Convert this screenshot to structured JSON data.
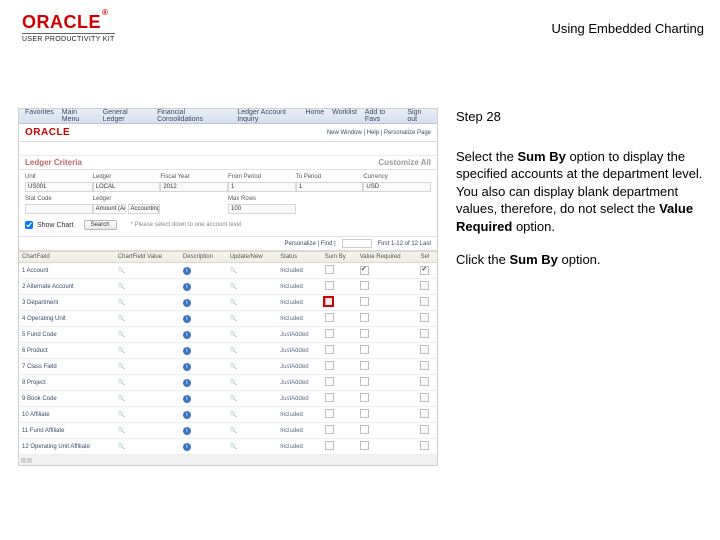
{
  "header": {
    "brand_main": "ORACLE",
    "brand_tm": "®",
    "brand_sub": "USER PRODUCTIVITY KIT",
    "doc_title": "Using Embedded Charting"
  },
  "instructions": {
    "step_label": "Step 28",
    "p1_a": "Select the ",
    "p1_b_bold": "Sum By",
    "p1_c": " option to display the specified accounts at the department level. You also can display blank department values, therefore, do not select the ",
    "p1_d_bold": "Value Required",
    "p1_e": " option.",
    "p2_a": "Click the ",
    "p2_b_bold": "Sum By",
    "p2_c": " option."
  },
  "shot": {
    "top_left": [
      "Favorites",
      "Main Menu",
      "General Ledger",
      "Financial Consolidations",
      "Ledger Account Inquiry"
    ],
    "top_right": [
      "Home",
      "Worklist",
      "Add to Favs",
      "Sign out"
    ],
    "brand": "ORACLE",
    "brand_links": "New Window | Help | Personalize Page",
    "panel_title": "Ledger Criteria",
    "panel_action": "Customize All",
    "filters": [
      {
        "label": "Unit",
        "v1": "US001"
      },
      {
        "label": "Ledger",
        "v1": "LOCAL"
      },
      {
        "label": "Fiscal Year",
        "v1": "2012"
      },
      {
        "label": "From Period",
        "v1": "1"
      },
      {
        "label": "To Period",
        "v1": "1"
      },
      {
        "label": "Currency",
        "v1": "USD"
      }
    ],
    "filters2": [
      {
        "label": "Stat Code",
        "v1": ""
      },
      {
        "label": "Ledger",
        "v1": "Amount (Actuals)",
        "v2": "Accounting Period"
      },
      {
        "label": "",
        "v1": ""
      },
      {
        "label": "Max Rows",
        "v1": "100"
      },
      {
        "label": "",
        "v1": ""
      }
    ],
    "show_chart_label": "Show Chart",
    "search_btn": "Search",
    "search_note": "* Please select down to one account level.",
    "pager_prev": "Personalize | Find |",
    "pager_range": "First  1-12 of 12  Last",
    "table": {
      "headers": [
        "ChartField",
        "ChartField Value",
        "Description",
        "Update/New",
        "Status",
        "Sum By",
        "Value Required",
        "Sel"
      ],
      "rows": [
        {
          "cf": "1 Account",
          "val": "",
          "status": "Included",
          "sum": false,
          "req": true,
          "sel": true
        },
        {
          "cf": "2 Alternate Account",
          "val": "",
          "status": "Included",
          "sum": false,
          "req": false,
          "sel": false
        },
        {
          "cf": "3 Department",
          "val": "",
          "status": "Included",
          "sum": false,
          "req": false,
          "sel": false,
          "hl": true
        },
        {
          "cf": "4 Operating Unit",
          "val": "",
          "status": "Included",
          "sum": false,
          "req": false,
          "sel": false
        },
        {
          "cf": "5 Fund Code",
          "val": "",
          "status": "JustAdded",
          "sum": false,
          "req": false,
          "sel": false
        },
        {
          "cf": "6 Product",
          "val": "",
          "status": "JustAdded",
          "sum": false,
          "req": false,
          "sel": false
        },
        {
          "cf": "7 Class Field",
          "val": "",
          "status": "JustAdded",
          "sum": false,
          "req": false,
          "sel": false
        },
        {
          "cf": "8 Project",
          "val": "",
          "status": "JustAdded",
          "sum": false,
          "req": false,
          "sel": false
        },
        {
          "cf": "9 Book Code",
          "val": "",
          "status": "JustAdded",
          "sum": false,
          "req": false,
          "sel": false
        },
        {
          "cf": "10 Affiliate",
          "val": "",
          "status": "Included",
          "sum": false,
          "req": false,
          "sel": false
        },
        {
          "cf": "11 Fund Affiliate",
          "val": "",
          "status": "Included",
          "sum": false,
          "req": false,
          "sel": false
        },
        {
          "cf": "12 Operating Unit Affiliate",
          "val": "",
          "status": "Included",
          "sum": false,
          "req": false,
          "sel": false
        }
      ]
    }
  }
}
